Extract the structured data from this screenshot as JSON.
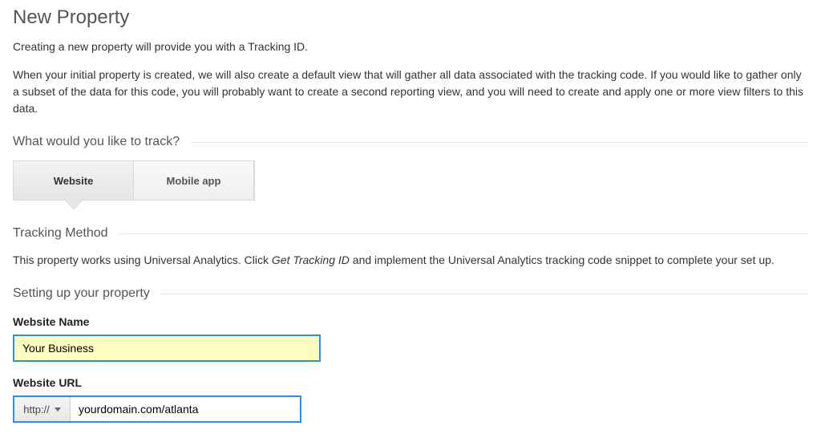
{
  "header": {
    "title": "New Property",
    "intro1": "Creating a new property will provide you with a Tracking ID.",
    "intro2": "When your initial property is created, we will also create a default view that will gather all data associated with the tracking code. If you would like to gather only a subset of the data for this code, you will probably want to create a second reporting view, and you will need to create and apply one or more view filters to this data."
  },
  "track": {
    "question": "What would you like to track?",
    "tabs": {
      "website": "Website",
      "mobile": "Mobile app"
    }
  },
  "method": {
    "heading": "Tracking Method",
    "desc_pre": "This property works using Universal Analytics. Click ",
    "desc_em": "Get Tracking ID",
    "desc_post": " and implement the Universal Analytics tracking code snippet to complete your set up."
  },
  "setup": {
    "heading": "Setting up your property",
    "website_name_label": "Website Name",
    "website_name_value": "Your Business",
    "website_url_label": "Website URL",
    "protocol": "http://",
    "website_url_value": "yourdomain.com/atlanta"
  }
}
